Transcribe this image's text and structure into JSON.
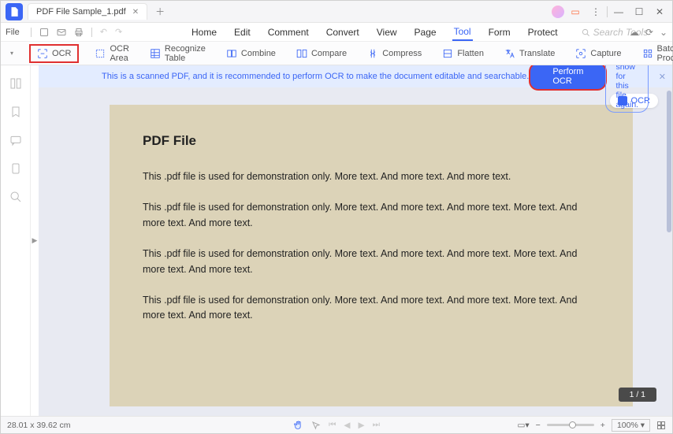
{
  "title_bar": {
    "tab_title": "PDF File Sample_1.pdf"
  },
  "file_row": {
    "file_label": "File"
  },
  "menu": {
    "items": [
      "Home",
      "Edit",
      "Comment",
      "Convert",
      "View",
      "Page",
      "Tool",
      "Form",
      "Protect"
    ],
    "active_index": 6,
    "search_placeholder": "Search Tools"
  },
  "toolbar": {
    "ocr": "OCR",
    "ocr_area": "OCR Area",
    "recognize_table": "Recognize Table",
    "combine": "Combine",
    "compare": "Compare",
    "compress": "Compress",
    "flatten": "Flatten",
    "translate": "Translate",
    "capture": "Capture",
    "batch_process": "Batch Process"
  },
  "banner": {
    "message": "This is a scanned PDF, and it is recommended to perform OCR to make the document editable and searchable.",
    "perform_btn": "Perform OCR",
    "dont_show": "Do not show for this file again."
  },
  "chip": {
    "label": "OCR"
  },
  "document": {
    "heading": "PDF File",
    "p1": "This .pdf file is used for demonstration only. More text. And more text. And more text.",
    "p2": "This .pdf file is used for demonstration only. More text. And more text. And more text. More text. And more text. And more text.",
    "p3": "This .pdf file is used for demonstration only. More text. And more text. And more text. More text. And more text. And more text.",
    "p4": "This .pdf file is used for demonstration only. More text. And more text. And more text. More text. And more text. And more text."
  },
  "page_indicator": "1 / 1",
  "status": {
    "dimensions": "28.01 x 39.62 cm",
    "zoom": "100%"
  }
}
